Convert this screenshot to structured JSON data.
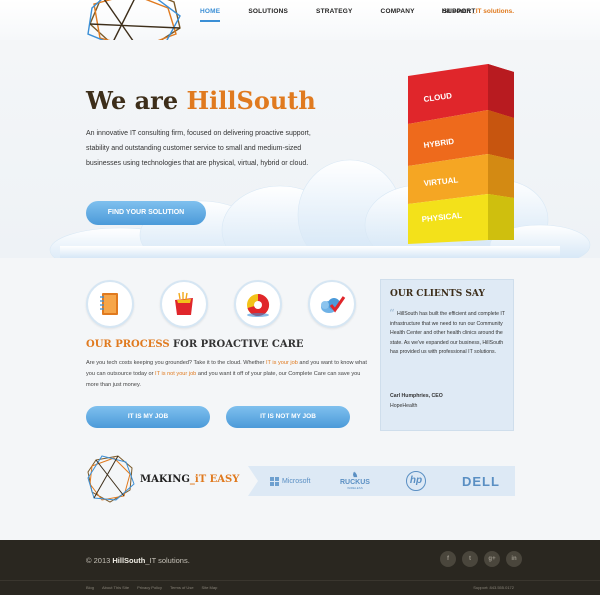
{
  "header": {
    "nav": [
      {
        "label": "HOME",
        "active": true
      },
      {
        "label": "SOLUTIONS",
        "active": false
      },
      {
        "label": "STRATEGY",
        "active": false
      },
      {
        "label": "COMPANY",
        "active": false
      },
      {
        "label": "SUPPORT",
        "active": false
      }
    ],
    "tagline_brand": "HillSouth",
    "tagline_accent": " _IT solutions."
  },
  "hero": {
    "title_prefix": "We are ",
    "title_brand": "HillSouth",
    "text": "An innovative IT consulting firm, focused on delivering proactive support, stability and outstanding customer service to small and medium-sized businesses using technologies that are physical, virtual, hybrid or cloud.",
    "button": "FIND YOUR SOLUTION",
    "tower_layers": [
      "CLOUD",
      "HYBRID",
      "VIRTUAL",
      "PHYSICAL"
    ]
  },
  "process": {
    "icons": [
      "notebook-icon",
      "shopping-bag-icon",
      "donut-chart-icon",
      "cloud-check-icon"
    ],
    "title_accent": "OUR PROCESS",
    "title_rest": " FOR PROACTIVE CARE",
    "text_1": "Are you tech costs keeping you grounded? Take it to the cloud. Whether ",
    "link_1": "IT is your job",
    "text_2": " and you want to know what you can outsource today or ",
    "link_2": "IT is not your job",
    "text_3": " and you want it off of your plate, our Complete Care can save you more than just money.",
    "btn_my_job": "IT IS MY JOB",
    "btn_not_my_job": "IT IS NOT MY JOB"
  },
  "clients": {
    "title": "OUR CLIENTS SAY",
    "quote": "HillSouth has built the efficient and complete IT infrastructure that we need to run our Community Health Center and other health clinics around the state. As we've expanded our business, HillSouth has provided us with professional IT solutions.",
    "name": "Carl Humphries, CEO",
    "org": "HopeHealth"
  },
  "partners": {
    "making_prefix": "MAKING",
    "making_accent": "_iT EASY",
    "logos": [
      "Microsoft",
      "RUCKUS",
      "hp",
      "DELL"
    ],
    "ruckus_sub": "WIRELESS"
  },
  "footer": {
    "copyright_prefix": "© 2013 ",
    "copyright_brand": "HillSouth",
    "copyright_suffix": "_IT solutions.",
    "socials": [
      "f",
      "t",
      "g+",
      "in"
    ],
    "links": [
      "Blog",
      "About This Site",
      "Privacy Policy",
      "Terms of Use",
      "Site Map"
    ],
    "support": "Support: 843.555.0172"
  }
}
